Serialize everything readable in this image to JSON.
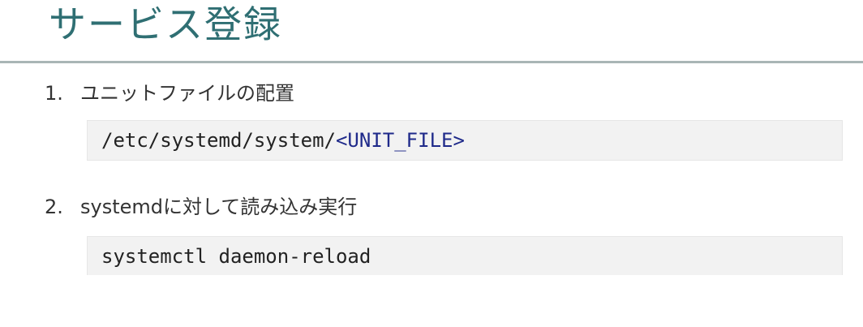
{
  "title": "サービス登録",
  "steps": [
    {
      "number": "1.",
      "text": "ユニットファイルの配置",
      "code_plain": "/etc/systemd/system/",
      "code_highlight": "<UNIT_FILE>"
    },
    {
      "number": "2.",
      "text": "systemdに対して読み込み実行",
      "code_plain": "systemctl daemon-reload",
      "code_highlight": ""
    }
  ],
  "colors": {
    "title": "#2f6f73",
    "rule": "#a9b6b6",
    "code_background": "#f2f2f2",
    "code_highlight": "#1f2a8a"
  }
}
